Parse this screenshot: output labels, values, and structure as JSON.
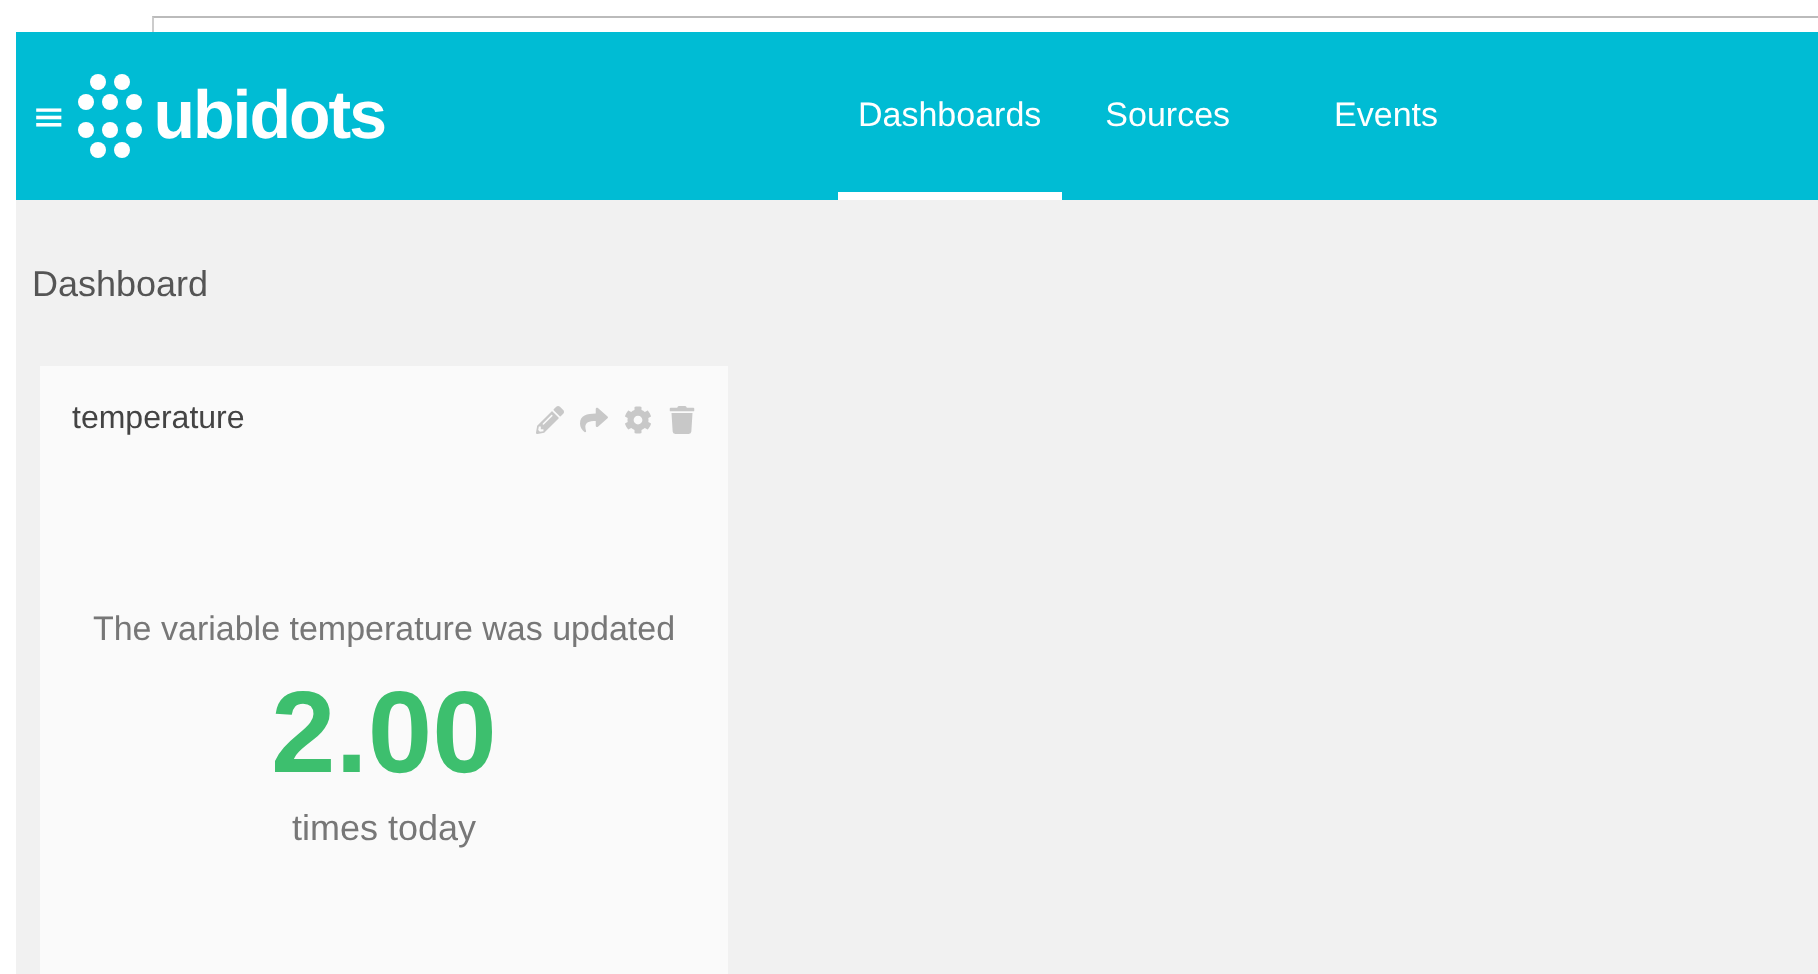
{
  "navbar": {
    "logo": "ubidots",
    "menu_icon": "≡",
    "tabs": [
      {
        "label": "Dashboards",
        "selected": true
      },
      {
        "label": "Sources",
        "selected": false
      },
      {
        "label": "Events",
        "selected": false
      }
    ]
  },
  "page_title": "Dashboard",
  "widget": {
    "title": "temperature",
    "message": "The variable temperature was updated",
    "value": "2.00",
    "unit_text": "times today"
  }
}
